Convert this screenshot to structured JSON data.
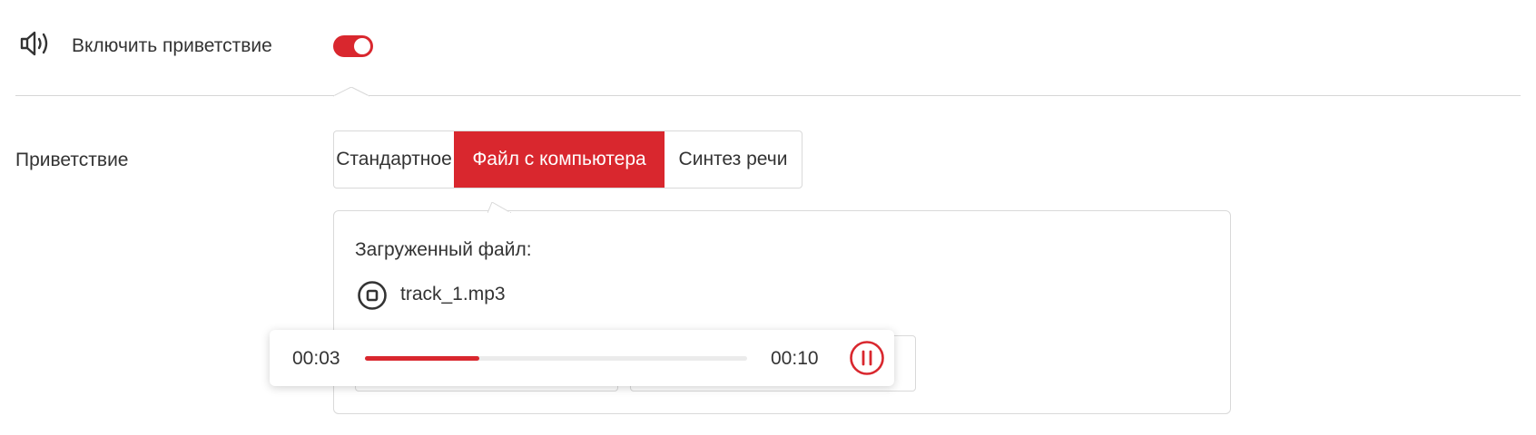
{
  "greeting_toggle": {
    "label": "Включить приветствие",
    "enabled": true,
    "icon": "speaker-icon"
  },
  "greeting": {
    "label": "Приветствие",
    "tabs": [
      {
        "label": "Стандартное",
        "active": false
      },
      {
        "label": "Файл с компьютера",
        "active": true
      },
      {
        "label": "Синтез речи",
        "active": false
      }
    ]
  },
  "file_panel": {
    "uploaded_label": "Загруженный файл:",
    "file_name": "track_1.mp3",
    "stop_icon": "stop-circle-icon"
  },
  "player": {
    "current_time": "00:03",
    "total_time": "00:10",
    "progress_percent": 30,
    "pause_icon": "pause-circle-icon"
  },
  "colors": {
    "accent": "#d9272e",
    "text": "#333333",
    "border": "#d9d9d9"
  }
}
